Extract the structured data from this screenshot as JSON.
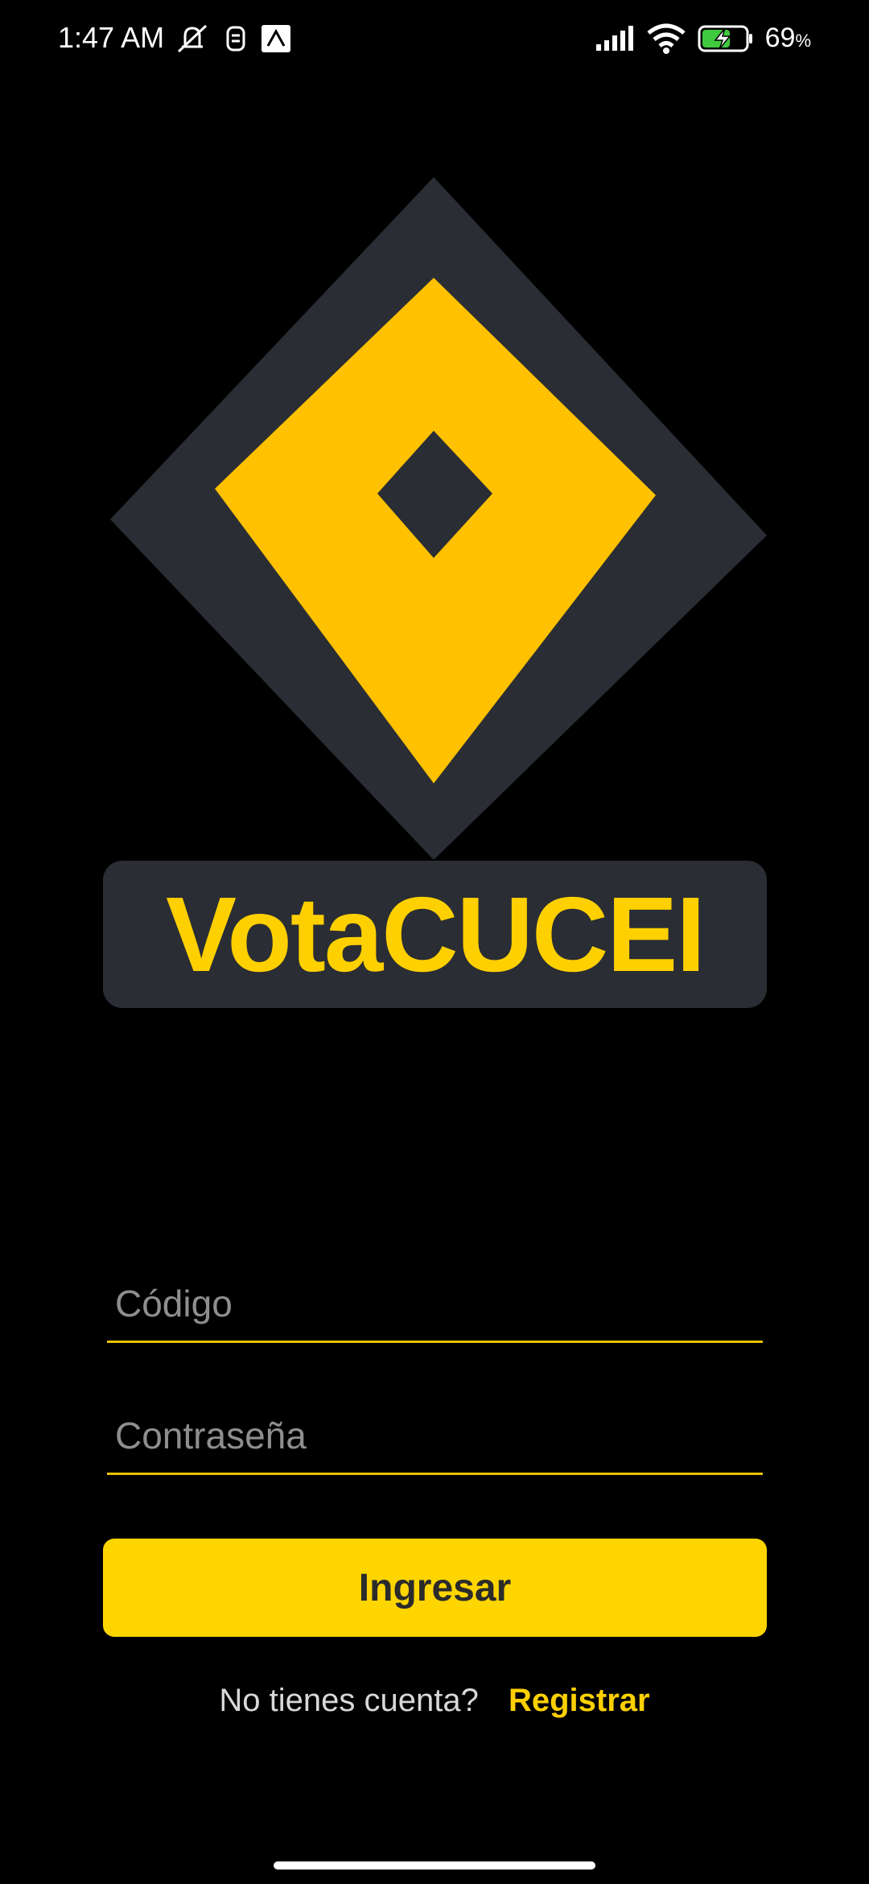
{
  "status_bar": {
    "time": "1:47 AM",
    "battery_percent": "69",
    "battery_unit": "%",
    "icons": [
      "mute-icon",
      "vpn-icon",
      "notification-icon",
      "signal-icon",
      "wifi-icon",
      "battery-charging-icon"
    ]
  },
  "brand": {
    "title": "VotaCUCEI",
    "colors": {
      "accent": "#ffd000",
      "dark": "#2a2d33"
    }
  },
  "form": {
    "code_placeholder": "Código",
    "password_placeholder": "Contraseña",
    "login_label": "Ingresar"
  },
  "signup": {
    "question": "No tienes cuenta?",
    "link_label": "Registrar"
  }
}
